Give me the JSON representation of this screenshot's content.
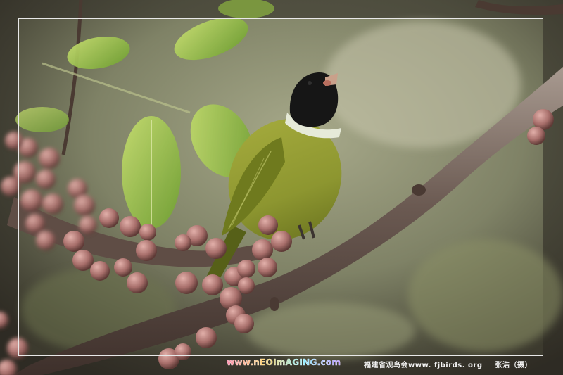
{
  "footer": {
    "watermark_site": "www.nEOImAGING.com",
    "credit_org": "福建省观鸟会www. fjbirds. org",
    "credit_author": "张浩（摄）"
  },
  "subject": {
    "colors": {
      "head": "#1a1a1a",
      "collar": "#e6ead8",
      "body": "#9aa238",
      "wing": "#6f7a1e",
      "branch": "#5a4a42",
      "fig": "#b07a78"
    }
  }
}
